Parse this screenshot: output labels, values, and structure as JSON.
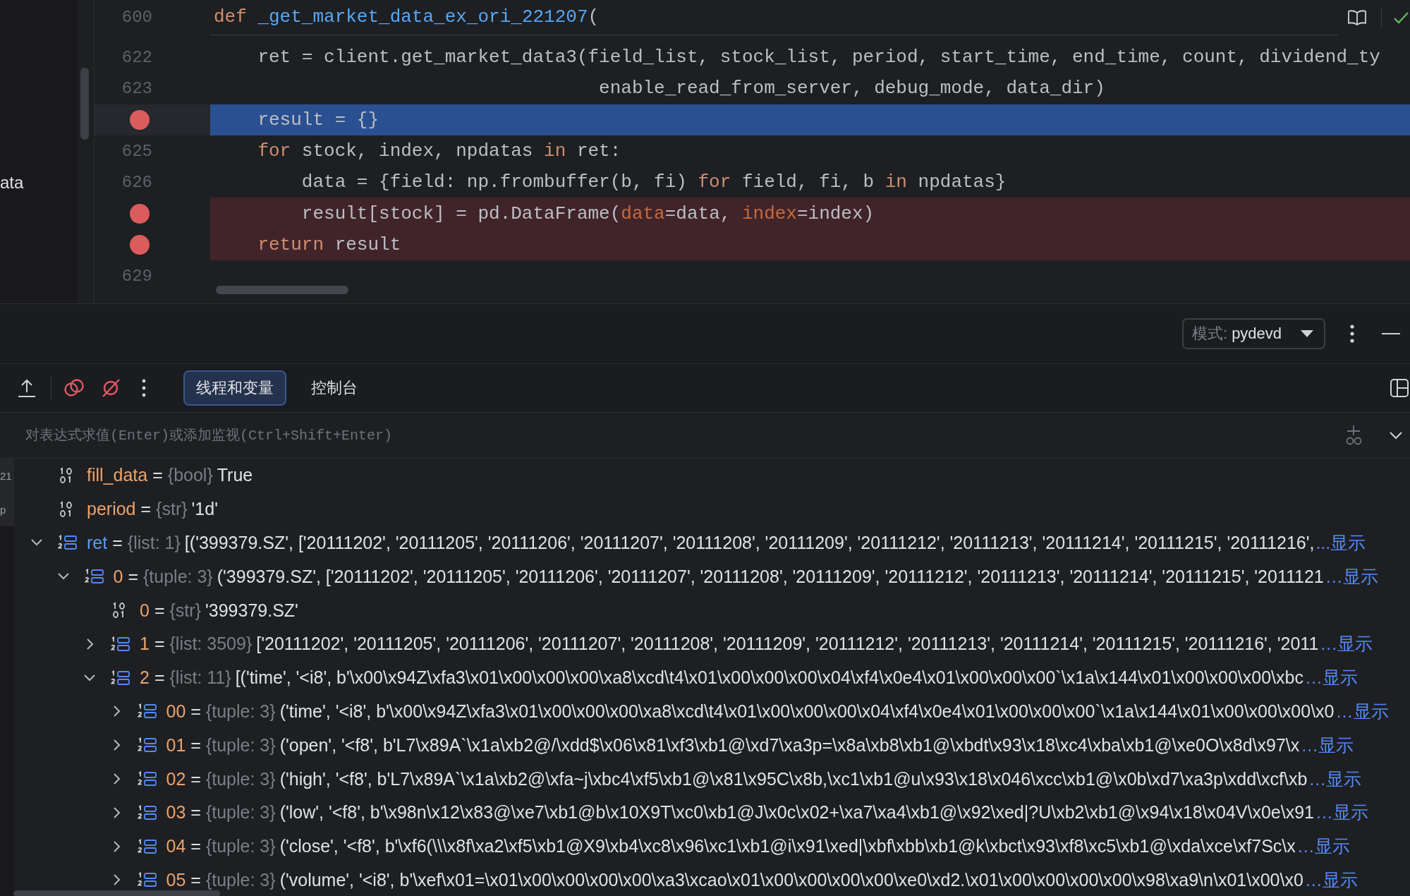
{
  "project_panel": {
    "fragment": "ata"
  },
  "editor": {
    "sticky_line": {
      "number": "600",
      "tokens": [
        {
          "text": "def",
          "kind": "keyword"
        },
        {
          "text": " _get_market_data_ex_ori_221207",
          "kind": "function"
        },
        {
          "text": "(",
          "kind": "plain"
        }
      ]
    },
    "lines": [
      {
        "number": "622",
        "breakpoint": false,
        "current": false,
        "tokens": [
          {
            "text": "    ret = client.get_market_data3(field_list, stock_list, period, start_time, end_time, count, dividend_ty",
            "kind": "plain"
          }
        ]
      },
      {
        "number": "623",
        "breakpoint": false,
        "current": false,
        "tokens": [
          {
            "text": "                                   enable_read_from_server, debug_mode, data_dir)",
            "kind": "plain"
          }
        ]
      },
      {
        "breakpoint": true,
        "current": true,
        "tokens": [
          {
            "text": "    result = {}",
            "kind": "plain"
          }
        ]
      },
      {
        "number": "625",
        "breakpoint": false,
        "current": false,
        "tokens": [
          {
            "text": "    for",
            "kind": "keyword"
          },
          {
            "text": " stock, index, npdatas ",
            "kind": "plain"
          },
          {
            "text": "in",
            "kind": "keyword"
          },
          {
            "text": " ret:",
            "kind": "plain"
          }
        ]
      },
      {
        "number": "626",
        "breakpoint": false,
        "current": false,
        "tokens": [
          {
            "text": "        data = {field: np.frombuffer(b, fi) ",
            "kind": "plain"
          },
          {
            "text": "for",
            "kind": "keyword"
          },
          {
            "text": " field, fi, b ",
            "kind": "plain"
          },
          {
            "text": "in",
            "kind": "keyword"
          },
          {
            "text": " npdatas}",
            "kind": "plain"
          }
        ]
      },
      {
        "breakpoint": true,
        "current": false,
        "tokens": [
          {
            "text": "        result[stock] = pd.DataFrame(",
            "kind": "plain"
          },
          {
            "text": "data",
            "kind": "named_arg"
          },
          {
            "text": "=data, ",
            "kind": "plain"
          },
          {
            "text": "index",
            "kind": "named_arg"
          },
          {
            "text": "=index)",
            "kind": "plain"
          }
        ]
      },
      {
        "breakpoint": true,
        "current": false,
        "tokens": [
          {
            "text": "    return",
            "kind": "keyword"
          },
          {
            "text": " result",
            "kind": "plain"
          }
        ]
      },
      {
        "number": "629",
        "breakpoint": false,
        "current": false
      }
    ]
  },
  "debug": {
    "mode": {
      "label": "模式:",
      "value": "pydevd"
    },
    "tabs": [
      {
        "label": "线程和变量",
        "selected": true
      },
      {
        "label": "控制台",
        "selected": false
      }
    ],
    "evaluate": {
      "placeholder": "对表达式求值(Enter)或添加监视(Ctrl+Shift+Enter)"
    },
    "side_fragments": [
      "21",
      "p"
    ],
    "variables": [
      {
        "kind": "primitive",
        "name": "fill_data",
        "changed": false,
        "sep": "=",
        "type": "{bool}",
        "value": "True"
      },
      {
        "kind": "primitive",
        "name": "period",
        "changed": false,
        "sep": "=",
        "type": "{str}",
        "value": "'1d'"
      },
      {
        "kind": "collection",
        "name": "ret",
        "changed": true,
        "sep": "=",
        "type": "{list: 1}",
        "value": "[('399379.SZ', ['20111202', '20111205', '20111206', '20111207', '20111208', '20111209', '20111212', '20111213', '20111214', '20111215', '20111216', ",
        "more": "...显示",
        "expanded": true,
        "children": [
          {
            "kind": "collection",
            "name": "0",
            "changed": false,
            "sep": "=",
            "type": "{tuple: 3}",
            "value": "('399379.SZ', ['20111202', '20111205', '20111206', '20111207', '20111208', '20111209', '20111212', '20111213', '20111214', '20111215', '2011121",
            "more": "…显示",
            "expanded": true,
            "children": [
              {
                "kind": "primitive",
                "name": "0",
                "changed": false,
                "sep": "=",
                "type": "{str}",
                "value": "'399379.SZ'"
              },
              {
                "kind": "collection",
                "name": "1",
                "changed": false,
                "sep": "=",
                "type": "{list: 3509}",
                "value": "['20111202', '20111205', '20111206', '20111207', '20111208', '20111209', '20111212', '20111213', '20111214', '20111215', '20111216', '2011",
                "more": "…显示",
                "expanded": false
              },
              {
                "kind": "collection",
                "name": "2",
                "changed": false,
                "sep": "=",
                "type": "{list: 11}",
                "value": "[('time', '<i8', b'\\x00\\x94Z\\xfa3\\x01\\x00\\x00\\x00\\xa8\\xcd\\t4\\x01\\x00\\x00\\x00\\x04\\xf4\\x0e4\\x01\\x00\\x00\\x00`\\x1a\\x144\\x01\\x00\\x00\\x00\\xbc",
                "more": "…显示",
                "expanded": true,
                "children": [
                  {
                    "kind": "collection",
                    "name": "00",
                    "changed": false,
                    "sep": "=",
                    "type": "{tuple: 3}",
                    "value": "('time', '<i8', b'\\x00\\x94Z\\xfa3\\x01\\x00\\x00\\x00\\xa8\\xcd\\t4\\x01\\x00\\x00\\x00\\x04\\xf4\\x0e4\\x01\\x00\\x00\\x00`\\x1a\\x144\\x01\\x00\\x00\\x00\\x0",
                    "more": "…显示",
                    "expanded": false
                  },
                  {
                    "kind": "collection",
                    "name": "01",
                    "changed": false,
                    "sep": "=",
                    "type": "{tuple: 3}",
                    "value": "('open', '<f8', b'L7\\x89A`\\x1a\\xb2@/\\xdd$\\x06\\x81\\xf3\\xb1@\\xd7\\xa3p=\\x8a\\xb8\\xb1@\\xbdt\\x93\\x18\\xc4\\xba\\xb1@\\xe0O\\x8d\\x97\\x",
                    "more": "…显示",
                    "expanded": false
                  },
                  {
                    "kind": "collection",
                    "name": "02",
                    "changed": false,
                    "sep": "=",
                    "type": "{tuple: 3}",
                    "value": "('high', '<f8', b'L7\\x89A`\\x1a\\xb2@\\xfa~j\\xbc4\\xf5\\xb1@\\x81\\x95C\\x8b,\\xc1\\xb1@u\\x93\\x18\\x046\\xcc\\xb1@\\x0b\\xd7\\xa3p\\xdd\\xcf\\xb",
                    "more": "…显示",
                    "expanded": false
                  },
                  {
                    "kind": "collection",
                    "name": "03",
                    "changed": false,
                    "sep": "=",
                    "type": "{tuple: 3}",
                    "value": "('low', '<f8', b'\\x98n\\x12\\x83@\\xe7\\xb1@b\\x10X9T\\xc0\\xb1@J\\x0c\\x02+\\xa7\\xa4\\xb1@\\x92\\xed|?U\\xb2\\xb1@\\x94\\x18\\x04V\\x0e\\x91",
                    "more": "…显示",
                    "expanded": false
                  },
                  {
                    "kind": "collection",
                    "name": "04",
                    "changed": false,
                    "sep": "=",
                    "type": "{tuple: 3}",
                    "value": "('close', '<f8', b'\\xf6(\\\\\\x8f\\xa2\\xf5\\xb1@X9\\xb4\\xc8\\x96\\xc1\\xb1@i\\x91\\xed|\\xbf\\xbb\\xb1@k\\xbct\\x93\\xf8\\xc5\\xb1@\\xda\\xce\\xf7Sc\\x",
                    "more": "…显示",
                    "expanded": false
                  },
                  {
                    "kind": "collection",
                    "name": "05",
                    "changed": false,
                    "sep": "=",
                    "type": "{tuple: 3}",
                    "value": "('volume', '<i8', b'\\xef\\x01=\\x01\\x00\\x00\\x00\\x00\\xa3\\xcao\\x01\\x00\\x00\\x00\\x00\\xe0\\xd2.\\x01\\x00\\x00\\x00\\x00\\x98\\xa9\\n\\x01\\x00\\x0",
                    "more": "…显示",
                    "expanded": false
                  }
                ]
              }
            ]
          }
        ]
      }
    ]
  }
}
